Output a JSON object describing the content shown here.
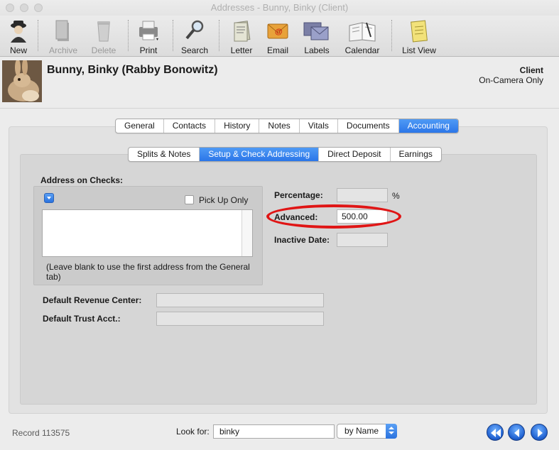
{
  "window": {
    "title": "Addresses - Bunny, Binky (Client)"
  },
  "toolbar": {
    "new": "New",
    "archive": "Archive",
    "delete": "Delete",
    "print": "Print",
    "search": "Search",
    "letter": "Letter",
    "email": "Email",
    "labels": "Labels",
    "calendar": "Calendar",
    "list_view": "List View"
  },
  "header": {
    "name": "Bunny, Binky (Rabby Bonowitz)",
    "type": "Client",
    "subtype": "On-Camera Only"
  },
  "main_tabs": [
    "General",
    "Contacts",
    "History",
    "Notes",
    "Vitals",
    "Documents",
    "Accounting"
  ],
  "main_tabs_active": "Accounting",
  "sub_tabs": [
    "Splits & Notes",
    "Setup & Check Addressing",
    "Direct Deposit",
    "Earnings"
  ],
  "sub_tabs_active": "Setup & Check Addressing",
  "form": {
    "address_label": "Address on Checks:",
    "pickup_label": "Pick Up Only",
    "address_value": "",
    "address_note": "(Leave blank to use the first address from the General tab)",
    "percentage_label": "Percentage:",
    "percentage_value": "",
    "percent_sign": "%",
    "advanced_label": "Advanced:",
    "advanced_value": "500.00",
    "inactive_label": "Inactive Date:",
    "inactive_value": "",
    "revenue_label": "Default Revenue Center:",
    "revenue_value": "",
    "trust_label": "Default Trust Acct.:",
    "trust_value": ""
  },
  "footer": {
    "record": "Record 113575",
    "lookfor_label": "Look for:",
    "search_value": "binky",
    "search_by": "by Name"
  },
  "colors": {
    "accent": "#2b76e8",
    "highlight": "#e01515"
  }
}
